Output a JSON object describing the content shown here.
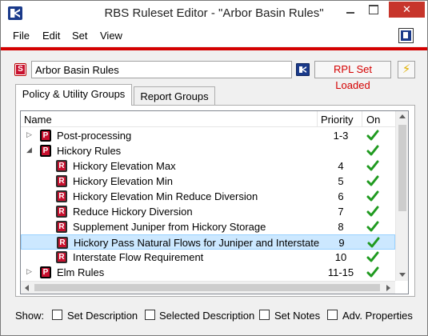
{
  "window": {
    "title": "RBS Ruleset Editor - \"Arbor Basin Rules\"",
    "close_glyph": "✕"
  },
  "menu": {
    "items": [
      "File",
      "Edit",
      "Set",
      "View"
    ]
  },
  "toolbar": {
    "set_badge": "S",
    "ruleset_name": "Arbor Basin Rules",
    "status_button": "RPL Set Loaded",
    "bolt_glyph": "⚡"
  },
  "tabs": [
    "Policy & Utility Groups",
    "Report Groups"
  ],
  "table": {
    "columns": [
      "Name",
      "Priority",
      "On"
    ],
    "rows": [
      {
        "type": "P",
        "expander": "▷",
        "label": "Post-processing",
        "priority": "1-3",
        "on": true,
        "level": 0
      },
      {
        "type": "P",
        "expander": "◢",
        "label": "Hickory Rules",
        "priority": "",
        "on": true,
        "level": 0
      },
      {
        "type": "R",
        "expander": "",
        "label": "Hickory Elevation Max",
        "priority": "4",
        "on": true,
        "level": 1
      },
      {
        "type": "R",
        "expander": "",
        "label": "Hickory Elevation Min",
        "priority": "5",
        "on": true,
        "level": 1
      },
      {
        "type": "R",
        "expander": "",
        "label": "Hickory Elevation Min Reduce Diversion",
        "priority": "6",
        "on": true,
        "level": 1
      },
      {
        "type": "R",
        "expander": "",
        "label": "Reduce Hickory Diversion",
        "priority": "7",
        "on": true,
        "level": 1
      },
      {
        "type": "R",
        "expander": "",
        "label": "Supplement Juniper from Hickory Storage",
        "priority": "8",
        "on": true,
        "level": 1
      },
      {
        "type": "R",
        "expander": "",
        "label": "Hickory Pass Natural Flows for Juniper and Interstate",
        "priority": "9",
        "on": true,
        "level": 1,
        "selected": true
      },
      {
        "type": "R",
        "expander": "",
        "label": "Interstate Flow Requirement",
        "priority": "10",
        "on": true,
        "level": 1
      },
      {
        "type": "P",
        "expander": "▷",
        "label": "Elm Rules",
        "priority": "11-15",
        "on": true,
        "level": 0
      }
    ]
  },
  "show_bar": {
    "label": "Show:",
    "options": [
      "Set Description",
      "Selected Description",
      "Set Notes",
      "Adv. Properties"
    ]
  },
  "colors": {
    "accent_red": "#d40000",
    "check_green": "#1f9a1f",
    "selection": "#cce8ff"
  }
}
